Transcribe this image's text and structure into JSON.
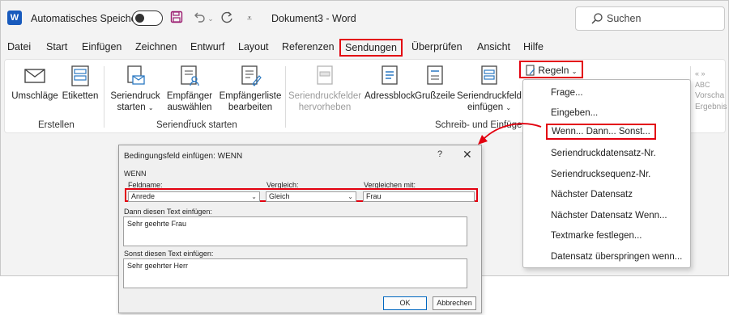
{
  "titlebar": {
    "autosave_label": "Automatisches Speichern",
    "doc_title": "Dokument3 - Word",
    "search_placeholder": "Suchen",
    "word_logo": "W"
  },
  "tabs": [
    "Datei",
    "Start",
    "Einfügen",
    "Zeichnen",
    "Entwurf",
    "Layout",
    "Referenzen",
    "Sendungen",
    "Überprüfen",
    "Ansicht",
    "Hilfe"
  ],
  "active_tab": "Sendungen",
  "ribbon": {
    "umschlaege": "Umschläge",
    "etiketten": "Etiketten",
    "group_erstellen": "Erstellen",
    "seriendruck_starten_1": "Seriendruck",
    "seriendruck_starten_2": "starten",
    "empfaenger_1": "Empfänger",
    "empfaenger_2": "auswählen",
    "empfaengerliste_1": "Empfängerliste",
    "empfaengerliste_2": "bearbeiten",
    "group_seriendruck": "Seriendruck starten",
    "seriendruckfelder_1": "Seriendruckfelder",
    "seriendruckfelder_2": "hervorheben",
    "adressblock": "Adressblock",
    "grusszeile": "Grußzeile",
    "seriendruckfeld_1": "Seriendruckfeld",
    "seriendruckfeld_2": "einfügen",
    "group_schreib": "Schreib- und Einfügefe",
    "regeln": "Regeln",
    "vorschau_1": "Vorscha",
    "vorschau_2": "Ergebnis",
    "abc": "ABC"
  },
  "rules_menu": [
    "Frage...",
    "Eingeben...",
    "Wenn... Dann... Sonst...",
    "Seriendruckdatensatz-Nr.",
    "Seriendrucksequenz-Nr.",
    "Nächster Datensatz",
    "Nächster Datensatz Wenn...",
    "Textmarke festlegen...",
    "Datensatz überspringen wenn..."
  ],
  "dialog": {
    "title": "Bedingungsfeld einfügen: WENN",
    "help": "?",
    "close": "✕",
    "section": "WENN",
    "feldname_label": "Feldname:",
    "vergleich_label": "Vergleich:",
    "vergleichen_mit_label": "Vergleichen mit:",
    "feldname_value": "Anrede",
    "vergleich_value": "Gleich",
    "vergleichen_mit_value": "Frau",
    "dann_label": "Dann diesen Text einfügen:",
    "dann_value": "Sehr geehrte Frau",
    "sonst_label": "Sonst diesen Text einfügen:",
    "sonst_value": "Sehr geehrter Herr",
    "ok": "OK",
    "cancel": "Abbrechen"
  },
  "colors": {
    "highlight": "#e3000f",
    "word_blue": "#185abd",
    "accent": "#0067c0"
  }
}
